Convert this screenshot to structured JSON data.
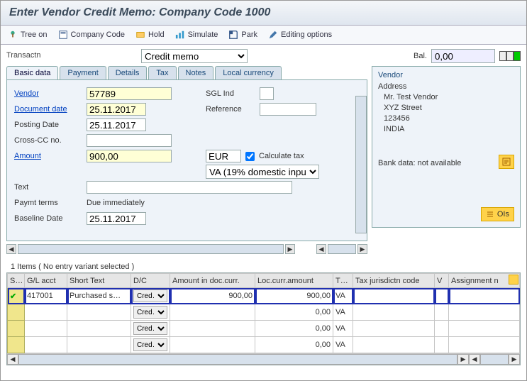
{
  "title": "Enter Vendor Credit Memo: Company Code 1000",
  "toolbar": {
    "tree_on": "Tree on",
    "company_code": "Company Code",
    "hold": "Hold",
    "simulate": "Simulate",
    "park": "Park",
    "editing_options": "Editing options"
  },
  "transactn_label": "Transactn",
  "transactn_value": "Credit memo",
  "bal_label": "Bal.",
  "bal_value": "0,00",
  "tabs": {
    "basic": "Basic data",
    "payment": "Payment",
    "details": "Details",
    "tax": "Tax",
    "notes": "Notes",
    "local_currency": "Local currency"
  },
  "form": {
    "vendor_label": "Vendor",
    "vendor_value": "57789",
    "document_date_label": "Document date",
    "document_date_value": "25.11.2017",
    "posting_date_label": "Posting Date",
    "posting_date_value": "25.11.2017",
    "cross_cc_label": "Cross-CC no.",
    "cross_cc_value": "",
    "amount_label": "Amount",
    "amount_value": "900,00",
    "currency": "EUR",
    "text_label": "Text",
    "text_value": "",
    "paymt_terms_label": "Paymt terms",
    "paymt_terms_value": "Due immediately",
    "baseline_date_label": "Baseline Date",
    "baseline_date_value": "25.11.2017",
    "sgl_ind_label": "SGL Ind",
    "sgl_ind_value": "",
    "reference_label": "Reference",
    "reference_value": "",
    "calc_tax_label": "Calculate tax",
    "calc_tax_checked": true,
    "tax_code_value": "VA (19% domestic inpu…"
  },
  "vendor": {
    "box_title": "Vendor",
    "address_label": "Address",
    "line1": "Mr. Test Vendor",
    "line2": "XYZ Street",
    "line3": "123456",
    "line4": "INDIA",
    "bank_note": "Bank data: not available",
    "ois_label": "OIs"
  },
  "grid": {
    "title": "1 Items ( No entry variant selected )",
    "headers": {
      "s": "S…",
      "gl_acct": "G/L acct",
      "short_text": "Short Text",
      "dc": "D/C",
      "amount_doc": "Amount in doc.curr.",
      "loc_amount": "Loc.curr.amount",
      "t": "T…",
      "tax_jur": "Tax jurisdictn code",
      "v": "V",
      "assignment": "Assignment n"
    },
    "rows": [
      {
        "status": "✔",
        "gl_acct": "417001",
        "short_text": "Purchased s…",
        "dc": "Cred…",
        "amount_doc": "900,00",
        "loc_amount": "900,00",
        "t": "VA",
        "tax_jur": "",
        "v": "",
        "assignment": ""
      },
      {
        "status": "",
        "gl_acct": "",
        "short_text": "",
        "dc": "Cred…",
        "amount_doc": "",
        "loc_amount": "0,00",
        "t": "VA",
        "tax_jur": "",
        "v": "",
        "assignment": ""
      },
      {
        "status": "",
        "gl_acct": "",
        "short_text": "",
        "dc": "Cred…",
        "amount_doc": "",
        "loc_amount": "0,00",
        "t": "VA",
        "tax_jur": "",
        "v": "",
        "assignment": ""
      },
      {
        "status": "",
        "gl_acct": "",
        "short_text": "",
        "dc": "Cred…",
        "amount_doc": "",
        "loc_amount": "0,00",
        "t": "VA",
        "tax_jur": "",
        "v": "",
        "assignment": ""
      }
    ]
  }
}
